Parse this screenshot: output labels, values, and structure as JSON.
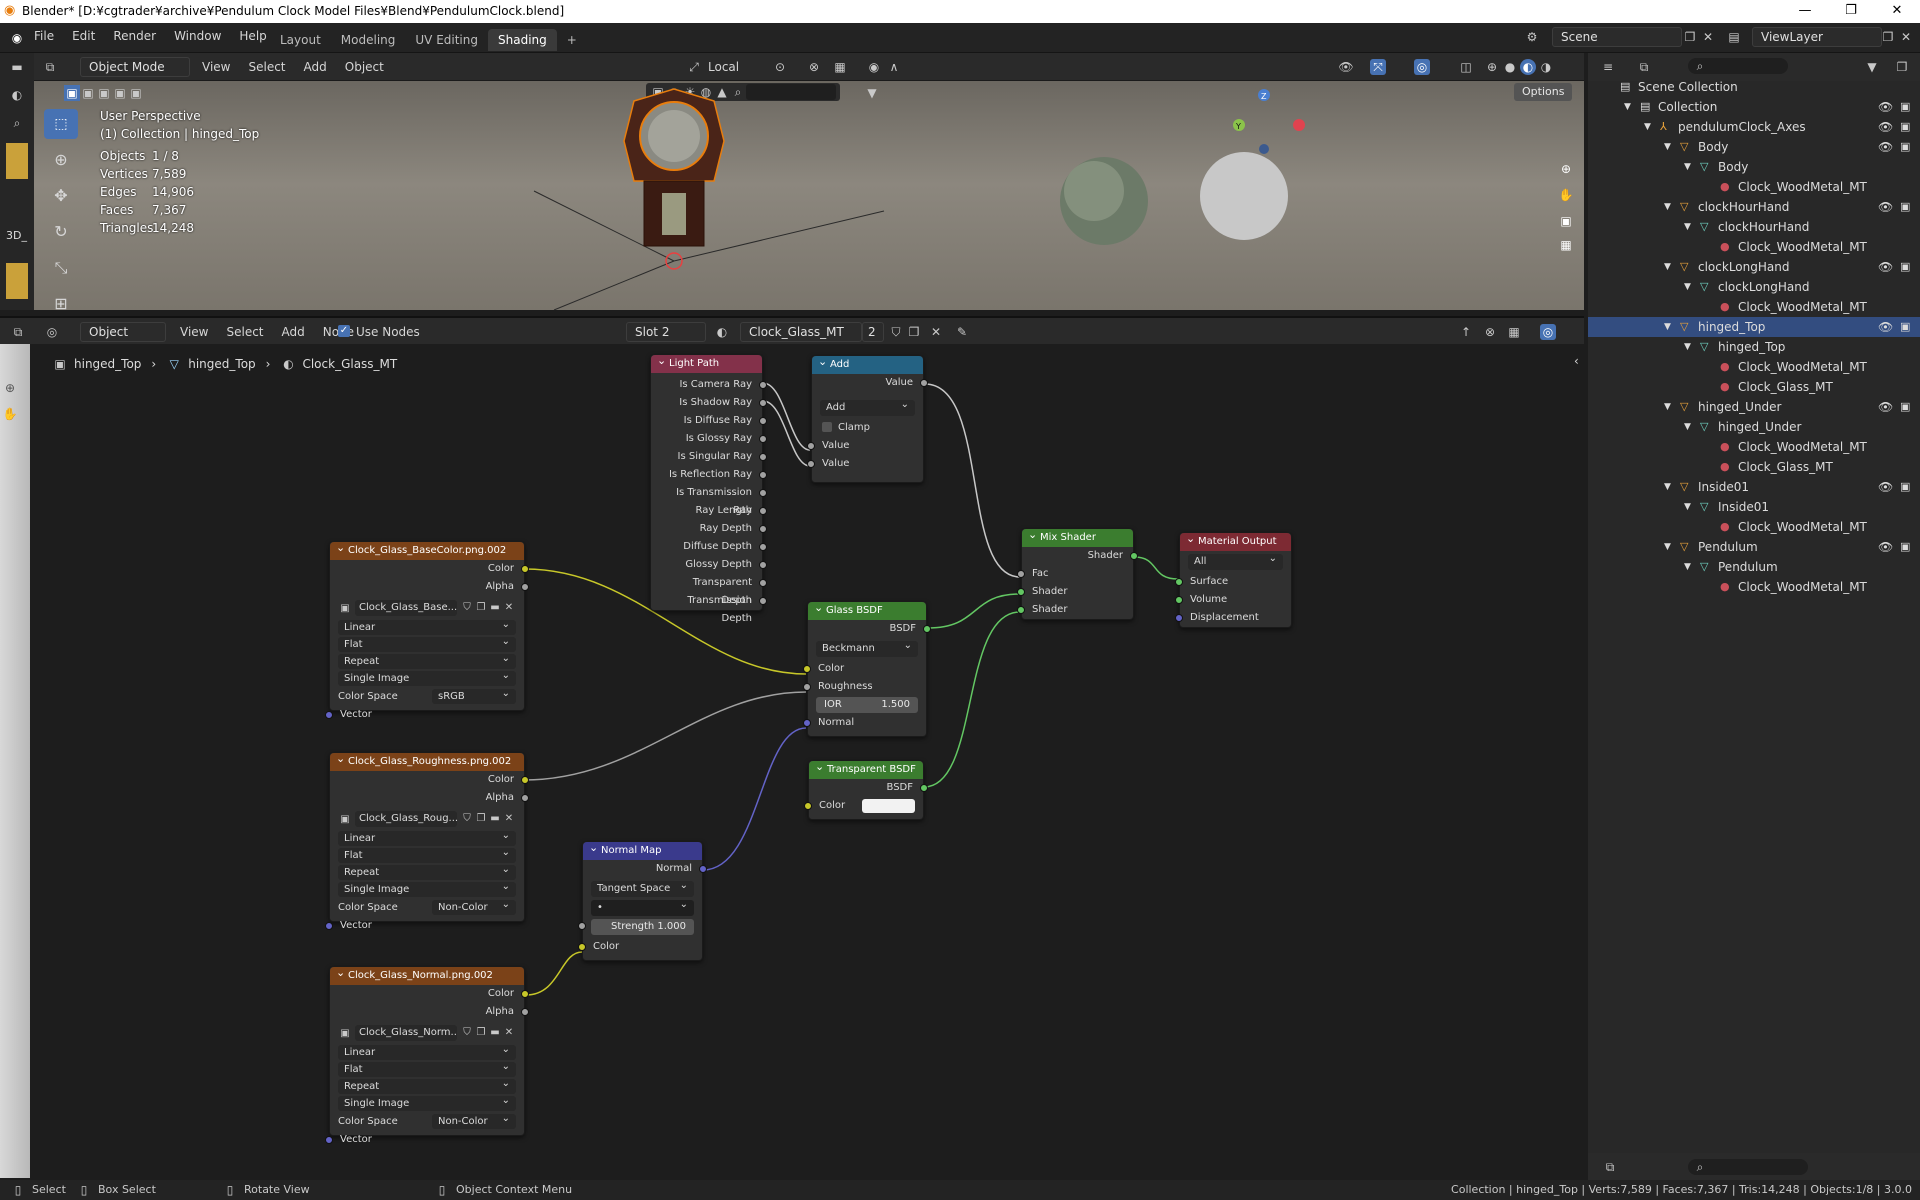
{
  "window": {
    "title": "Blender* [D:¥cgtrader¥archive¥Pendulum Clock Model Files¥Blend¥PendulumClock.blend]",
    "min": "—",
    "max": "❐",
    "close": "✕"
  },
  "menu": [
    "File",
    "Edit",
    "Render",
    "Window",
    "Help"
  ],
  "workspaces": [
    "Layout",
    "Modeling",
    "UV Editing",
    "Shading",
    "+"
  ],
  "active_workspace": "Shading",
  "scene": {
    "label": "Scene",
    "viewlayer": "ViewLayer"
  },
  "viewport": {
    "mode": "Object Mode",
    "menus": [
      "View",
      "Select",
      "Add",
      "Object"
    ],
    "orientation": "Local",
    "options": "Options",
    "info": {
      "perspective": "User Perspective",
      "collection": "(1) Collection | hinged_Top",
      "stats": [
        {
          "k": "Objects",
          "v": "1 / 8"
        },
        {
          "k": "Vertices",
          "v": "7,589"
        },
        {
          "k": "Edges",
          "v": "14,906"
        },
        {
          "k": "Faces",
          "v": "7,367"
        },
        {
          "k": "Triangles",
          "v": "14,248"
        }
      ]
    },
    "side_label": "3D_"
  },
  "node_editor": {
    "type": "Object",
    "menus": [
      "View",
      "Select",
      "Add",
      "Node"
    ],
    "use_nodes": "Use Nodes",
    "slot": "Slot 2",
    "material": "Clock_Glass_MT",
    "users": "2",
    "breadcrumb": [
      "hinged_Top",
      "hinged_Top",
      "Clock_Glass_MT"
    ]
  },
  "nodes": {
    "light_path": {
      "title": "Light Path",
      "outputs": [
        "Is Camera Ray",
        "Is Shadow Ray",
        "Is Diffuse Ray",
        "Is Glossy Ray",
        "Is Singular Ray",
        "Is Reflection Ray",
        "Is Transmission Ray",
        "Ray Length",
        "Ray Depth",
        "Diffuse Depth",
        "Glossy Depth",
        "Transparent Depth",
        "Transmission Depth"
      ]
    },
    "add": {
      "title": "Add",
      "out": "Value",
      "op": "Add",
      "clamp": "Clamp",
      "in1": "Value",
      "in2": "Value"
    },
    "mix": {
      "title": "Mix Shader",
      "out": "Shader",
      "fac": "Fac",
      "s1": "Shader",
      "s2": "Shader"
    },
    "output": {
      "title": "Material Output",
      "target": "All",
      "surface": "Surface",
      "volume": "Volume",
      "displacement": "Displacement"
    },
    "glass": {
      "title": "Glass BSDF",
      "out": "BSDF",
      "dist": "Beckmann",
      "color": "Color",
      "rough": "Roughness",
      "ior_label": "IOR",
      "ior": "1.500",
      "normal": "Normal"
    },
    "transparent": {
      "title": "Transparent BSDF",
      "out": "BSDF",
      "color": "Color"
    },
    "normal_map": {
      "title": "Normal Map",
      "out": "Normal",
      "space": "Tangent Space",
      "uv": "•",
      "strength_label": "Strength",
      "strength": "1.000",
      "color": "Color"
    },
    "tex1": {
      "title": "Clock_Glass_BaseColor.png.002",
      "img": "Clock_Glass_Base...",
      "interp": "Linear",
      "proj": "Flat",
      "ext": "Repeat",
      "src": "Single Image",
      "cs_label": "Color Space",
      "cs": "sRGB"
    },
    "tex2": {
      "title": "Clock_Glass_Roughness.png.002",
      "img": "Clock_Glass_Roug...",
      "interp": "Linear",
      "proj": "Flat",
      "ext": "Repeat",
      "src": "Single Image",
      "cs_label": "Color Space",
      "cs": "Non-Color"
    },
    "tex3": {
      "title": "Clock_Glass_Normal.png.002",
      "img": "Clock_Glass_Norm...",
      "interp": "Linear",
      "proj": "Flat",
      "ext": "Repeat",
      "src": "Single Image",
      "cs_label": "Color Space",
      "cs": "Non-Color"
    },
    "tex_common": {
      "color": "Color",
      "alpha": "Alpha",
      "vector": "Vector"
    }
  },
  "outliner": {
    "rows": [
      {
        "label": "Scene Collection",
        "depth": 0,
        "icon": "scene-collection-icon",
        "sel": false,
        "vis": false
      },
      {
        "label": "Collection",
        "depth": 1,
        "icon": "collection-icon",
        "sel": false,
        "vis": true
      },
      {
        "label": "pendulumClock_Axes",
        "depth": 2,
        "icon": "empty-icon",
        "sel": false,
        "vis": true
      },
      {
        "label": "Body",
        "depth": 3,
        "icon": "object-icon",
        "sel": false,
        "vis": true
      },
      {
        "label": "Body",
        "depth": 4,
        "icon": "mesh-icon",
        "sel": false,
        "vis": false
      },
      {
        "label": "Clock_WoodMetal_MT",
        "depth": 5,
        "icon": "material-icon",
        "sel": false,
        "vis": false
      },
      {
        "label": "clockHourHand",
        "depth": 3,
        "icon": "object-icon",
        "sel": false,
        "vis": true
      },
      {
        "label": "clockHourHand",
        "depth": 4,
        "icon": "mesh-icon",
        "sel": false,
        "vis": false
      },
      {
        "label": "Clock_WoodMetal_MT",
        "depth": 5,
        "icon": "material-icon",
        "sel": false,
        "vis": false
      },
      {
        "label": "clockLongHand",
        "depth": 3,
        "icon": "object-icon",
        "sel": false,
        "vis": true
      },
      {
        "label": "clockLongHand",
        "depth": 4,
        "icon": "mesh-icon",
        "sel": false,
        "vis": false
      },
      {
        "label": "Clock_WoodMetal_MT",
        "depth": 5,
        "icon": "material-icon",
        "sel": false,
        "vis": false
      },
      {
        "label": "hinged_Top",
        "depth": 3,
        "icon": "object-icon",
        "sel": true,
        "vis": true
      },
      {
        "label": "hinged_Top",
        "depth": 4,
        "icon": "mesh-icon",
        "sel": false,
        "vis": false
      },
      {
        "label": "Clock_WoodMetal_MT",
        "depth": 5,
        "icon": "material-icon",
        "sel": false,
        "vis": false
      },
      {
        "label": "Clock_Glass_MT",
        "depth": 5,
        "icon": "material-icon",
        "sel": false,
        "vis": false
      },
      {
        "label": "hinged_Under",
        "depth": 3,
        "icon": "object-icon",
        "sel": false,
        "vis": true
      },
      {
        "label": "hinged_Under",
        "depth": 4,
        "icon": "mesh-icon",
        "sel": false,
        "vis": false
      },
      {
        "label": "Clock_WoodMetal_MT",
        "depth": 5,
        "icon": "material-icon",
        "sel": false,
        "vis": false
      },
      {
        "label": "Clock_Glass_MT",
        "depth": 5,
        "icon": "material-icon",
        "sel": false,
        "vis": false
      },
      {
        "label": "Inside01",
        "depth": 3,
        "icon": "object-icon",
        "sel": false,
        "vis": true
      },
      {
        "label": "Inside01",
        "depth": 4,
        "icon": "mesh-icon",
        "sel": false,
        "vis": false
      },
      {
        "label": "Clock_WoodMetal_MT",
        "depth": 5,
        "icon": "material-icon",
        "sel": false,
        "vis": false
      },
      {
        "label": "Pendulum",
        "depth": 3,
        "icon": "object-icon",
        "sel": false,
        "vis": true
      },
      {
        "label": "Pendulum",
        "depth": 4,
        "icon": "mesh-icon",
        "sel": false,
        "vis": false
      },
      {
        "label": "Clock_WoodMetal_MT",
        "depth": 5,
        "icon": "material-icon",
        "sel": false,
        "vis": false
      }
    ]
  },
  "status": {
    "select": "Select",
    "box_select": "Box Select",
    "rotate": "Rotate View",
    "context": "Object Context Menu",
    "info": "Collection | hinged_Top | Verts:7,589 | Faces:7,367 | Tris:14,248 | Objects:1/8 | 3.0.0"
  },
  "colors": {
    "accent": "#4772b3",
    "header_input": "#83314a",
    "header_converter": "#246283",
    "header_shader": "#3b7d2f",
    "header_output": "#7d2a33",
    "header_texture": "#7b4218",
    "header_vector": "#3a3a8c"
  }
}
